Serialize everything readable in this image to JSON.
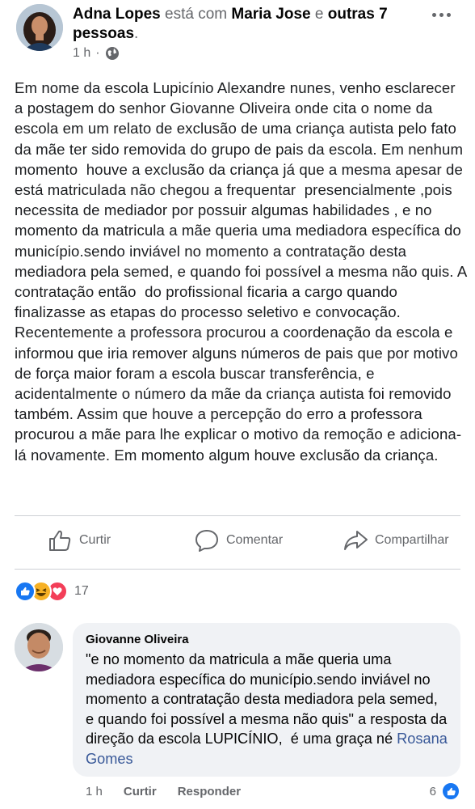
{
  "post": {
    "author": "Adna Lopes",
    "with_text": " está com ",
    "tagged": "Maria Jose",
    "and_text": " e ",
    "others": "outras 7 pessoas",
    "period": ".",
    "time": "1 h",
    "separator": "·",
    "body": "Em nome da escola Lupicínio Alexandre nunes, venho esclarecer a postagem do senhor Giovanne Oliveira onde cita o nome da escola em um relato de exclusão de uma criança autista pelo fato da mãe ter sido removida do grupo de pais da escola. Em nenhum momento  houve a exclusão da criança já que a mesma apesar de está matriculada não chegou a frequentar  presencialmente ,pois  necessita de mediador por possuir algumas habilidades , e no momento da matricula a mãe queria uma mediadora específica do município.sendo inviável no momento a contratação desta mediadora pela semed, e quando foi possível a mesma não quis. A contratação então  do profissional ficaria a cargo quando finalizasse as etapas do processo seletivo e convocação. Recentemente a professora procurou a coordenação da escola e informou que iria remover alguns números de pais que por motivo de força maior foram a escola buscar transferência, e acidentalmente o número da mãe da criança autista foi removido também. Assim que houve a percepção do erro a professora procurou a mãe para lhe explicar o motivo da remoção e adiciona-lá novamente. Em momento algum houve exclusão da criança."
  },
  "actions": {
    "like": "Curtir",
    "comment": "Comentar",
    "share": "Compartilhar"
  },
  "reactions": {
    "count": "17",
    "types": [
      "like",
      "haha",
      "love"
    ]
  },
  "comment": {
    "author": "Giovanne Oliveira",
    "text": "\"e no momento da matricula a mãe queria uma mediadora específica do município.sendo inviável no momento a contratação desta mediadora pela semed, e quando foi possível a mesma não quis\" a resposta da direção da escola LUPICÍNIO,  é uma graça né ",
    "mention": "Rosana Gomes",
    "time": "1 h",
    "like_label": "Curtir",
    "reply_label": "Responder",
    "likes": "6"
  },
  "colors": {
    "like_blue": "#1877f2",
    "haha_yellow": "#f7b125",
    "love_red": "#f33e58",
    "muted": "#65676b"
  }
}
